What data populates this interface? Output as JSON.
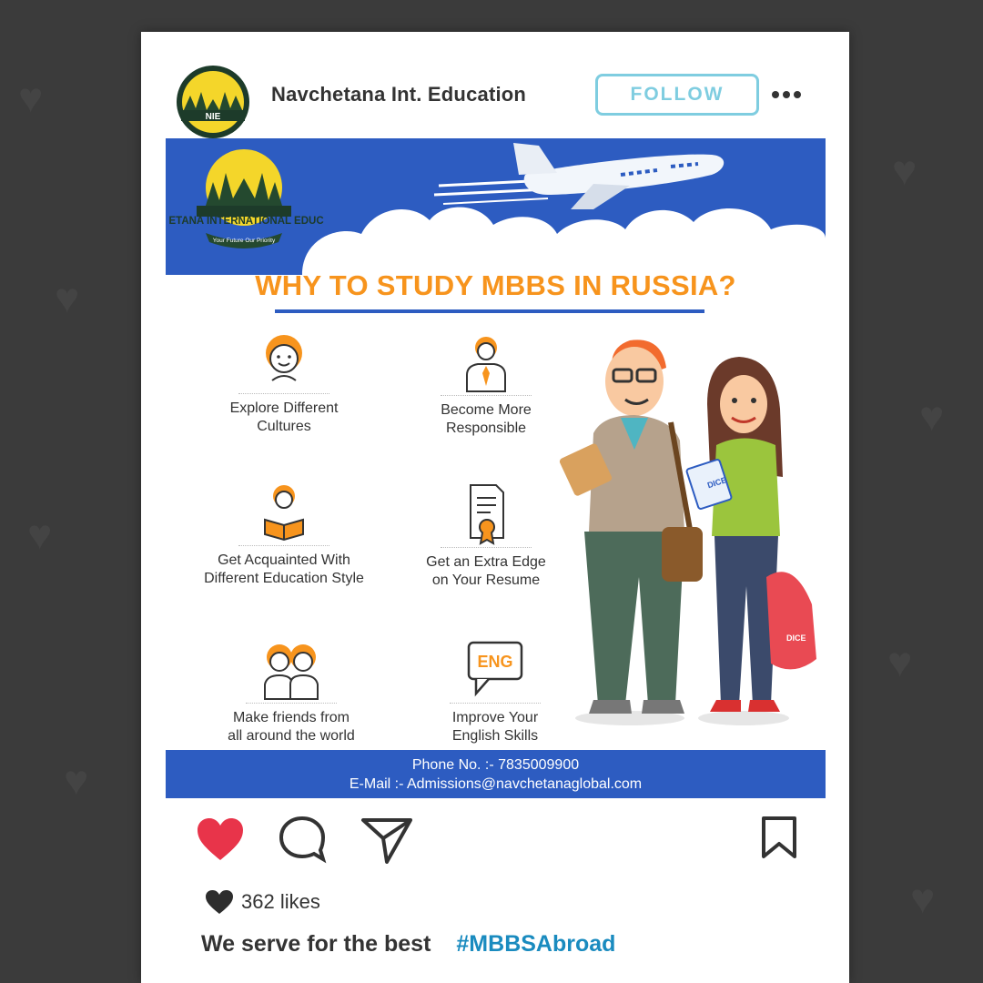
{
  "post": {
    "account_name": "Navchetana Int. Education",
    "follow_label": "FOLLOW",
    "more_icon": "more-dots-icon",
    "avatar_text": "NIE"
  },
  "image": {
    "logo_title": "NAVCHETANA INTERNATIONAL EDUCATION",
    "logo_tagline": "Your Future Our Priority",
    "headline": "WHY TO STUDY MBBS IN RUSSIA?",
    "benefits": [
      {
        "icon": "smiling-girl-icon",
        "label": "Explore Different\nCultures"
      },
      {
        "icon": "businessman-icon",
        "label": "Become More\nResponsible"
      },
      {
        "icon": "student-reading-icon",
        "label": "Get Acquainted With\nDifferent Education Style"
      },
      {
        "icon": "certificate-icon",
        "label": "Get an Extra Edge\non Your Resume"
      },
      {
        "icon": "friends-icon",
        "label": "Make friends from\nall around the world"
      },
      {
        "icon": "eng-speech-bubble-icon",
        "label": "Improve Your\nEnglish Skills",
        "badge": "ENG"
      }
    ],
    "book_label": "DICE",
    "bag_label": "DICE",
    "phone_line": "Phone No. :- 7835009900",
    "email_line": "E-Mail :- Admissions@navchetanaglobal.com"
  },
  "actions": {
    "like_icon": "heart-icon",
    "comment_icon": "comment-icon",
    "share_icon": "send-icon",
    "save_icon": "bookmark-icon"
  },
  "likes": {
    "icon": "heart-small-icon",
    "text": "362 likes"
  },
  "caption": {
    "text": "We serve for the best",
    "hashtag": "#MBBSAbroad"
  },
  "colors": {
    "accent_orange": "#f7941d",
    "brand_blue": "#2d5cc1",
    "follow_cyan": "#7fcde0",
    "like_red": "#e8344a",
    "hashtag_blue": "#1a8bbf"
  }
}
